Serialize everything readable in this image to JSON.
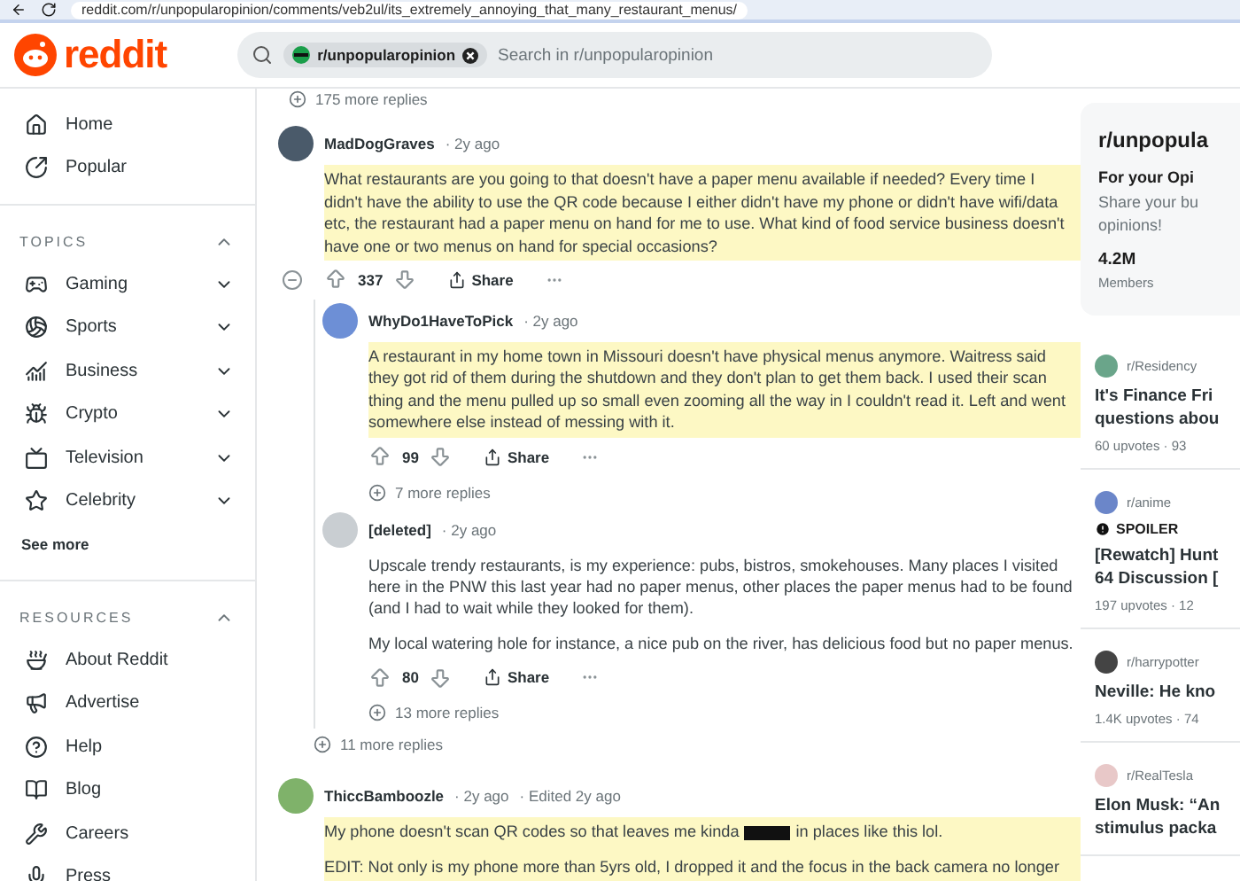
{
  "browser": {
    "url": "reddit.com/r/unpopularopinion/comments/veb2ul/its_extremely_annoying_that_many_restaurant_menus/"
  },
  "header": {
    "logo": "reddit",
    "search_chip": "r/unpopularopinion",
    "search_placeholder": "Search in r/unpopularopinion"
  },
  "sidebar": {
    "nav": [
      {
        "label": "Home",
        "selected": false
      },
      {
        "label": "Popular",
        "selected": false
      }
    ],
    "sections": [
      {
        "kind": "topics",
        "title": "TOPICS",
        "expanded": true,
        "items": [
          "Gaming",
          "Sports",
          "Business",
          "Crypto",
          "Television",
          "Celebrity"
        ],
        "see_more": "See more"
      },
      {
        "kind": "resources",
        "title": "RESOURCES",
        "expanded": true,
        "items": [
          "About Reddit",
          "Advertise",
          "Help",
          "Blog",
          "Careers",
          "Press"
        ]
      }
    ]
  },
  "thread": {
    "top_more_replies": "175 more replies",
    "comments": [
      {
        "author": "MadDogGraves",
        "meta": [
          "· 2y ago"
        ],
        "highlighted": true,
        "paragraphs": [
          {
            "kind": "text",
            "text": "What restaurants are you going to that doesn't have a paper menu available if needed? Every time I didn't have the ability to use the QR code because I either didn't have my phone or didn't have wifi/data etc, the restaurant had a paper menu on hand for me to use. What kind of food service business doesn't have one or two menus on hand for special occasions?"
          }
        ],
        "votes": "337",
        "share": "Share",
        "more_replies": "11 more replies",
        "children": [
          {
            "author": "WhyDo1HaveToPick",
            "meta": [
              "· 2y ago"
            ],
            "highlighted": true,
            "paragraphs": [
              {
                "kind": "text",
                "text": "A restaurant in my home town in Missouri doesn't have physical menus anymore. Waitress said they got rid of them during the shutdown and they don't plan to get them back. I used their scan thing and the menu pulled up so small even zooming all the way in I couldn't read it. Left and went somewhere else instead of messing with it."
              }
            ],
            "votes": "99",
            "share": "Share",
            "more_replies": "7 more replies"
          },
          {
            "author": "[deleted]",
            "meta": [
              "· 2y ago"
            ],
            "highlighted": false,
            "paragraphs": [
              {
                "kind": "text",
                "text": "Upscale trendy restaurants, is my experience: pubs, bistros, smokehouses. Many places I visited here in the PNW this last year had no paper menus, other places the paper menus had to be found (and I had to wait while they looked for them)."
              },
              {
                "kind": "text",
                "text": "My local watering hole for instance, a nice pub on the river, has delicious food but no paper menus."
              }
            ],
            "votes": "80",
            "share": "Share",
            "more_replies": "13 more replies"
          }
        ]
      },
      {
        "author": "ThiccBamboozle",
        "meta": [
          "· 2y ago",
          "· Edited 2y ago"
        ],
        "highlighted": true,
        "paragraphs": [
          {
            "kind": "redacted",
            "before": "My phone doesn't scan QR codes so that leaves me kinda",
            "after": "in places like this lol."
          },
          {
            "kind": "text",
            "text": "EDIT: Not only is my phone more than 5yrs old, I dropped it and the focus in the back camera no longer"
          }
        ]
      }
    ]
  },
  "community": {
    "title": "r/unpopula",
    "heading": "For your Opi",
    "description": "Share your bu opinions!",
    "members": "4.2M",
    "members_label": "Members"
  },
  "posts": [
    {
      "community": "r/Residency",
      "title": [
        "It's Finance Fri",
        "questions abou"
      ],
      "stats": "60 upvotes · 93"
    },
    {
      "community": "r/anime",
      "spoiler": "SPOILER",
      "title": [
        "[Rewatch] Hunt",
        "64 Discussion ["
      ],
      "stats": "197 upvotes · 12"
    },
    {
      "community": "r/harrypotter",
      "title": [
        "Neville: He kno"
      ],
      "stats": "1.4K upvotes · 74"
    },
    {
      "community": "r/RealTesla",
      "title": [
        "Elon Musk: “An",
        "stimulus packa"
      ]
    }
  ]
}
